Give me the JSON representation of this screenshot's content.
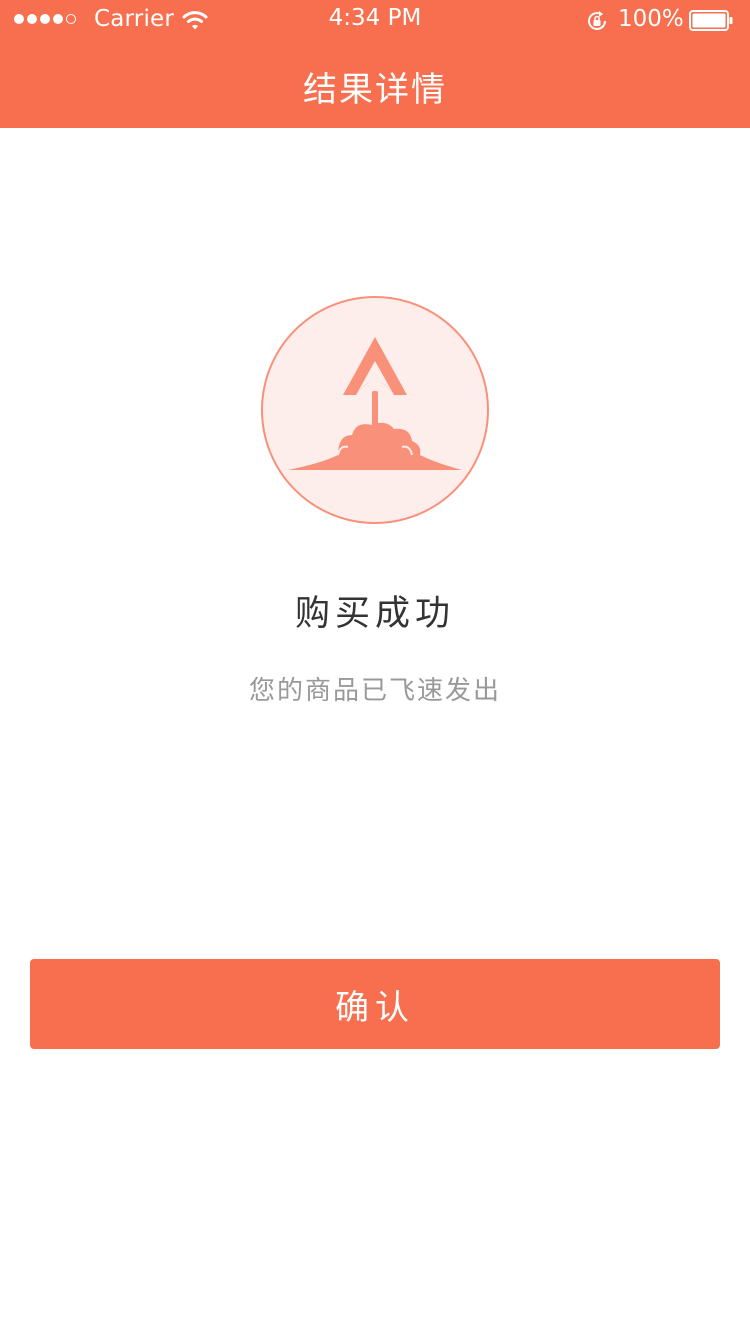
{
  "status_bar": {
    "carrier": "Carrier",
    "time": "4:34 PM",
    "battery_percent": "100%",
    "signal_bars_filled": 4,
    "signal_bars_total": 5
  },
  "nav": {
    "title": "结果详情"
  },
  "result": {
    "icon": "rocket-launch-icon",
    "title": "购买成功",
    "subtitle": "您的商品已飞速发出"
  },
  "actions": {
    "confirm_label": "确认"
  },
  "colors": {
    "accent": "#f76f4f",
    "icon_light": "#f9907a",
    "icon_bg": "#fdeeeb",
    "title_text": "#333333",
    "subtitle_text": "#999999"
  }
}
